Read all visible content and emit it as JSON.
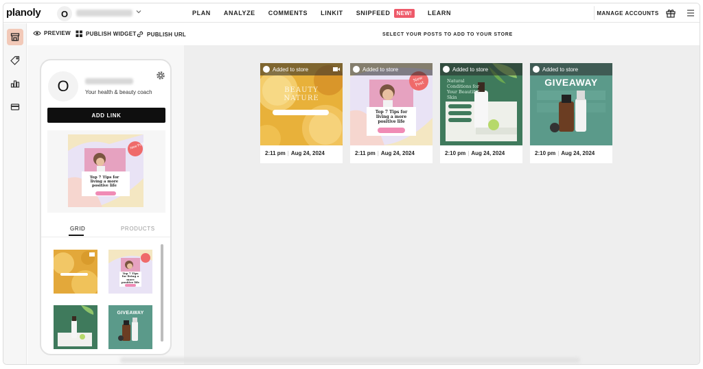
{
  "topnav": {
    "logo": "planoly",
    "account_avatar": "O",
    "links": [
      "PLAN",
      "ANALYZE",
      "COMMENTS",
      "LINKIT",
      "SNIPFEED",
      "LEARN"
    ],
    "new_badge": "NEW!",
    "manage_accounts": "MANAGE ACCOUNTS",
    "icons": [
      "gift-icon",
      "menu-icon"
    ]
  },
  "sidebar": {
    "items": [
      "store-icon",
      "tag-icon",
      "analytics-icon",
      "card-icon"
    ],
    "active_color": "#f2c9b8"
  },
  "subbar": {
    "preview": "PREVIEW",
    "publish_widget": "PUBLISH WIDGET",
    "publish_url": "PUBLISH URL",
    "title": "SELECT YOUR POSTS TO ADD TO YOUR STORE"
  },
  "phone": {
    "avatar": "O",
    "bio": "Your health & beauty coach",
    "add_link": "ADD LINK",
    "tabs": {
      "grid": "GRID",
      "products": "PRODUCTS"
    },
    "featured_post": {
      "badge": "New Post",
      "text": "Top 7 Tips for living a more positive life"
    }
  },
  "posts": [
    {
      "status": "Added to store",
      "time": "2:11 pm",
      "date": "Aug 24, 2024",
      "video": true,
      "art": "BEAUTY NATURE"
    },
    {
      "status": "Added to store",
      "time": "2:11 pm",
      "date": "Aug 24, 2024",
      "video": false,
      "badge": "New Post",
      "art": "Top 7 Tips for living a more positive life"
    },
    {
      "status": "Added to store",
      "time": "2:10 pm",
      "date": "Aug 24, 2024",
      "video": false,
      "art": "Natural Conditions for Your Beautiful Skin"
    },
    {
      "status": "Added to store",
      "time": "2:10 pm",
      "date": "Aug 24, 2024",
      "video": false,
      "art": "GIVEAWAY"
    }
  ],
  "mini_grid": {
    "post2_art": "Top 7 Tips for living a more positive life",
    "post4_art": "GIVEAWAY"
  },
  "colors": {
    "accent": "#ee5a6a",
    "overlay": "#282828",
    "green_post": "#3f7a5c",
    "teal_post": "#5b9a8a",
    "lemon_post": "#e8b13a"
  }
}
